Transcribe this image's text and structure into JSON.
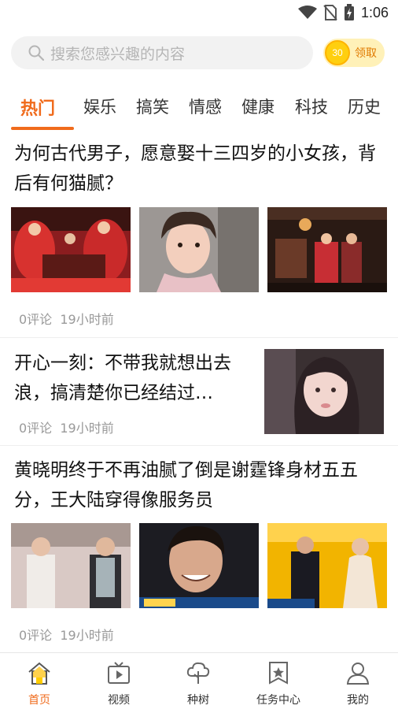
{
  "status_bar": {
    "time": "1:06"
  },
  "search": {
    "placeholder": "搜索您感兴趣的内容"
  },
  "reward": {
    "coin_value": "30",
    "label": "领取"
  },
  "tabs": [
    {
      "label": "热门",
      "active": true
    },
    {
      "label": "娱乐"
    },
    {
      "label": "搞笑"
    },
    {
      "label": "情感"
    },
    {
      "label": "健康"
    },
    {
      "label": "科技"
    },
    {
      "label": "历史"
    }
  ],
  "articles": [
    {
      "title": "为何古代男子，愿意娶十三四岁的小女孩，背后有何猫腻？",
      "comments": "0评论",
      "time": "19小时前"
    },
    {
      "title": "开心一刻：不带我就想出去浪，搞清楚你已经结过…",
      "comments": "0评论",
      "time": "19小时前"
    },
    {
      "title": "黄晓明终于不再油腻了倒是谢霆锋身材五五分，王大陆穿得像服务员",
      "comments": "0评论",
      "time": "19小时前"
    }
  ],
  "bottom_nav": [
    {
      "label": "首页",
      "icon": "home-icon",
      "active": true
    },
    {
      "label": "视频",
      "icon": "video-icon"
    },
    {
      "label": "种树",
      "icon": "tree-icon"
    },
    {
      "label": "任务中心",
      "icon": "task-icon"
    },
    {
      "label": "我的",
      "icon": "profile-icon"
    }
  ],
  "colors": {
    "accent": "#f06b1c",
    "meta": "#999999",
    "coin": "#ffcf0f"
  }
}
